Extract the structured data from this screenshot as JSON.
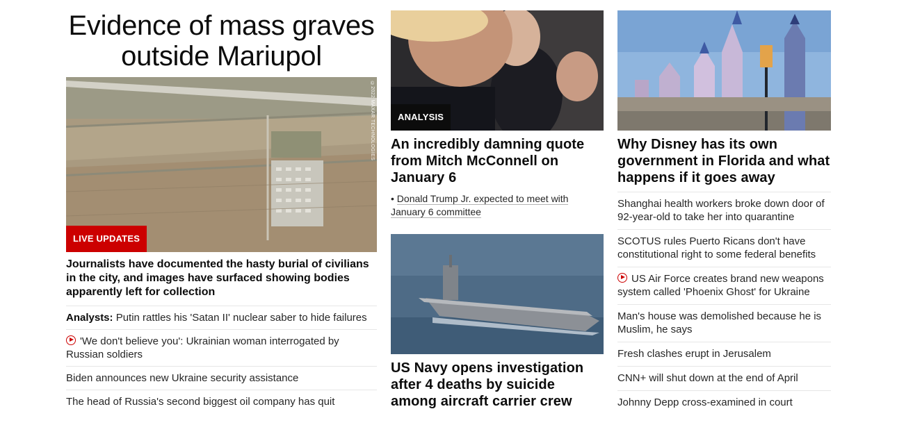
{
  "lead": {
    "title": "Evidence of mass graves outside Mariupol",
    "badge": "LIVE UPDATES",
    "credit": "©2022 MAXAR TECHNOLOGIES",
    "summary": "Journalists have documented the hasty burial of civilians in the city, and images have surfaced showing bodies apparently left for collection",
    "items": [
      {
        "prefix": "Analysts:",
        "text": "Putin rattles his 'Satan II' nuclear saber to hide failures",
        "video": false
      },
      {
        "prefix": "",
        "text": "'We don't believe you': Ukrainian woman interrogated by Russian soldiers",
        "video": true
      },
      {
        "prefix": "",
        "text": "Biden announces new Ukraine security assistance",
        "video": false
      },
      {
        "prefix": "",
        "text": "The head of Russia's second biggest oil company has quit",
        "video": false
      }
    ]
  },
  "middle": {
    "card1": {
      "badge": "ANALYSIS",
      "headline": "An incredibly damning quote from Mitch McConnell on January 6",
      "related": "Donald Trump Jr. expected to meet with January 6 committee",
      "bullet": "•"
    },
    "card2": {
      "headline": "US Navy opens investigation after 4 deaths by suicide among aircraft carrier crew"
    }
  },
  "right": {
    "headline": "Why Disney has its own government in Florida and what happens if it goes away",
    "items": [
      {
        "text": "Shanghai health workers broke down door of 92-year-old to take her into quarantine",
        "video": false
      },
      {
        "text": "SCOTUS rules Puerto Ricans don't have constitutional right to some federal benefits",
        "video": false
      },
      {
        "text": "US Air Force creates brand new weapons system called 'Phoenix Ghost' for Ukraine",
        "video": true
      },
      {
        "text": "Man's house was demolished because he is Muslim, he says",
        "video": false
      },
      {
        "text": "Fresh clashes erupt in Jerusalem",
        "video": false
      },
      {
        "text": "CNN+ will shut down at the end of April",
        "video": false
      },
      {
        "text": "Johnny Depp cross-examined in court",
        "video": false
      }
    ]
  },
  "icons": {
    "video": "play-circle-icon"
  },
  "colors": {
    "live_badge": "#cc0000",
    "analysis_badge": "#0c0c0c",
    "video_icon": "#cc0000"
  }
}
